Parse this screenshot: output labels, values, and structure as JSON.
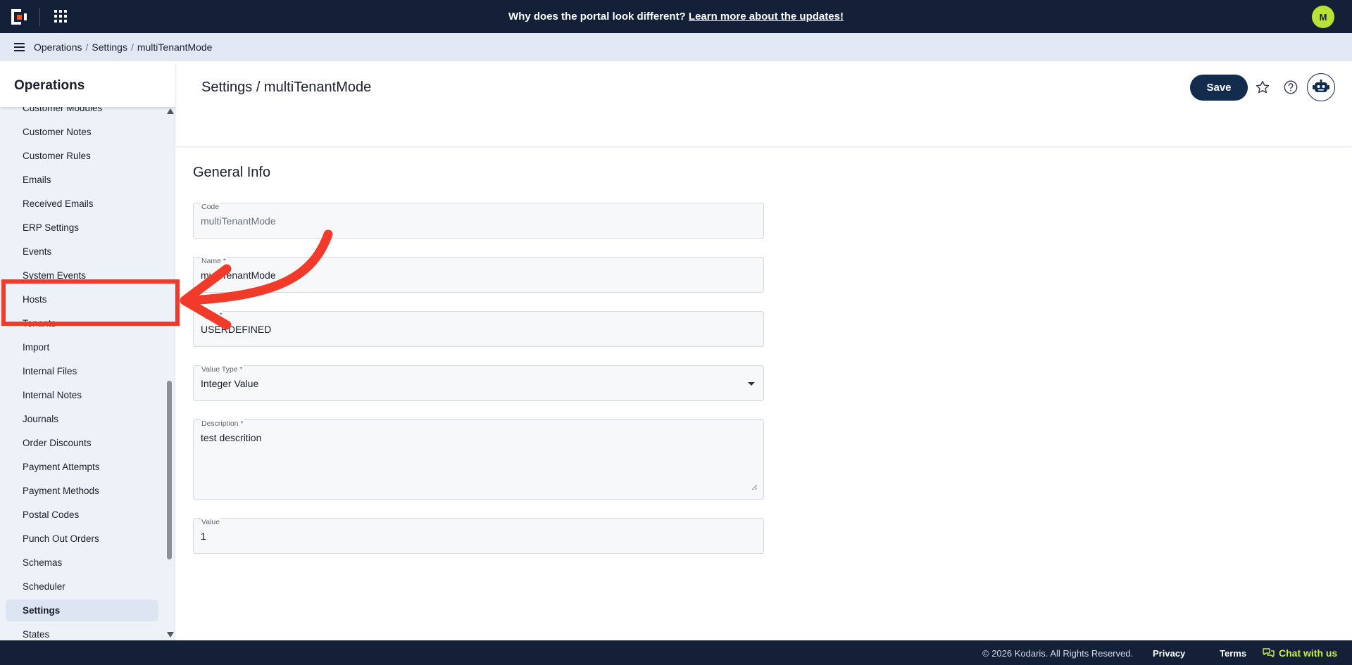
{
  "topbar": {
    "announcement_text": "Why does the portal look different?",
    "announcement_link": "Learn more about the updates!",
    "avatar_initial": "M"
  },
  "breadcrumb": [
    "Operations",
    "Settings",
    "multiTenantMode"
  ],
  "sidebar": {
    "title": "Operations",
    "items": [
      {
        "label": "Customer Modules"
      },
      {
        "label": "Customer Notes"
      },
      {
        "label": "Customer Rules"
      },
      {
        "label": "Emails"
      },
      {
        "label": "Received Emails"
      },
      {
        "label": "ERP Settings"
      },
      {
        "label": "Events"
      },
      {
        "label": "System Events"
      },
      {
        "label": "Hosts"
      },
      {
        "label": "Tenants"
      },
      {
        "label": "Import"
      },
      {
        "label": "Internal Files"
      },
      {
        "label": "Internal Notes"
      },
      {
        "label": "Journals"
      },
      {
        "label": "Order Discounts"
      },
      {
        "label": "Payment Attempts"
      },
      {
        "label": "Payment Methods"
      },
      {
        "label": "Postal Codes"
      },
      {
        "label": "Punch Out Orders"
      },
      {
        "label": "Schemas"
      },
      {
        "label": "Scheduler"
      },
      {
        "label": "Settings",
        "active": true
      },
      {
        "label": "States"
      }
    ]
  },
  "header": {
    "title": "Settings / multiTenantMode",
    "save_label": "Save"
  },
  "form": {
    "section_title": "General Info",
    "code": {
      "label": "Code",
      "value": "multiTenantMode"
    },
    "name": {
      "label": "Name *",
      "value": "multiTenantMode"
    },
    "type": {
      "label": "Type *",
      "value": "USERDEFINED"
    },
    "value_type": {
      "label": "Value Type *",
      "value": "Integer Value"
    },
    "description": {
      "label": "Description *",
      "value": "test descrition"
    },
    "value": {
      "label": "Value",
      "value": "1"
    }
  },
  "footer": {
    "copyright": "© 2026 Kodaris. All Rights Reserved.",
    "privacy": "Privacy",
    "terms": "Terms",
    "chat": "Chat with us"
  },
  "colors": {
    "topbar_bg": "#132038",
    "accent_button": "#132b4d",
    "annotation": "#f23a2b",
    "chat_green": "#c8ee47"
  }
}
